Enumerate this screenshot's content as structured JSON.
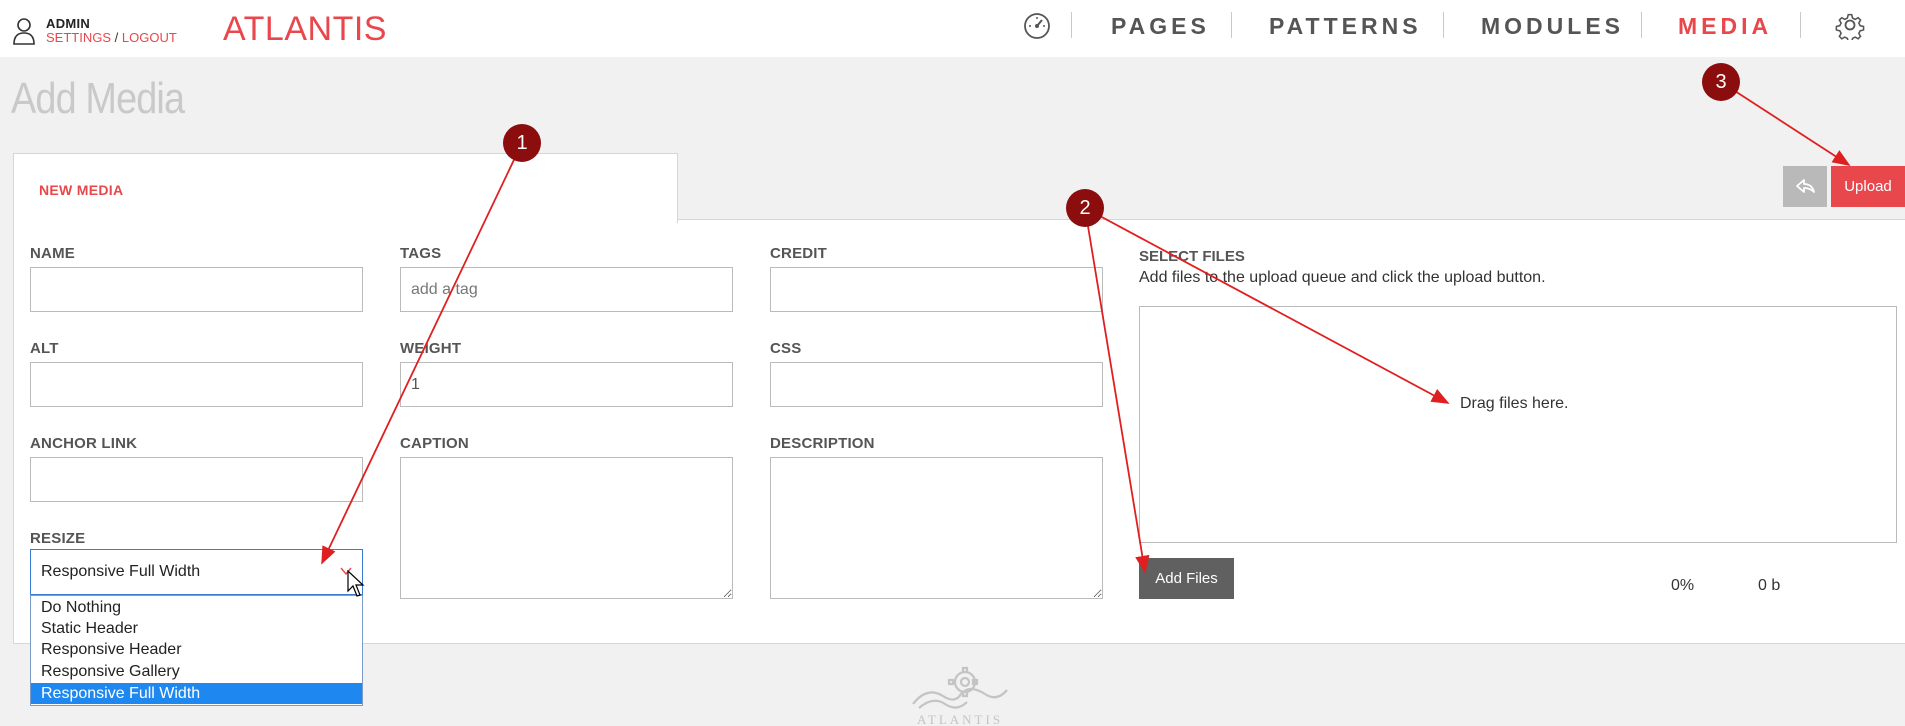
{
  "header": {
    "user_name": "ADMIN",
    "settings_link": "SETTINGS",
    "separator": "/",
    "logout_link": "LOGOUT",
    "brand": "ATLANTIS",
    "nav": {
      "pages": "PAGES",
      "patterns": "PATTERNS",
      "modules": "MODULES",
      "media": "MEDIA"
    },
    "active_nav": "MEDIA",
    "accent_color": "#e8474c"
  },
  "page": {
    "title": "Add Media",
    "tab_label": "NEW MEDIA",
    "upload_button": "Upload"
  },
  "form": {
    "name_label": "NAME",
    "name_value": "",
    "tags_label": "TAGS",
    "tags_placeholder": "add a tag",
    "credit_label": "CREDIT",
    "credit_value": "",
    "alt_label": "ALT",
    "alt_value": "",
    "weight_label": "WEIGHT",
    "weight_value": "1",
    "css_label": "CSS",
    "css_value": "",
    "anchor_label": "ANCHOR LINK",
    "anchor_value": "",
    "caption_label": "CAPTION",
    "caption_value": "",
    "description_label": "DESCRIPTION",
    "description_value": "",
    "resize_label": "RESIZE",
    "resize_selected": "Responsive Full Width",
    "resize_options": [
      "Do Nothing",
      "Static Header",
      "Responsive Header",
      "Responsive Gallery",
      "Responsive Full Width"
    ]
  },
  "files": {
    "label": "SELECT FILES",
    "help_text": "Add files to the upload queue and click the upload button.",
    "drop_text": "Drag files here.",
    "add_button": "Add Files",
    "progress": "0%",
    "size": "0 b"
  },
  "footer": {
    "logo_text": "ATLANTIS"
  },
  "annotations": {
    "markers": [
      "1",
      "2",
      "3"
    ],
    "color": "#8b0d0d",
    "arrow_color": "#e02020"
  }
}
